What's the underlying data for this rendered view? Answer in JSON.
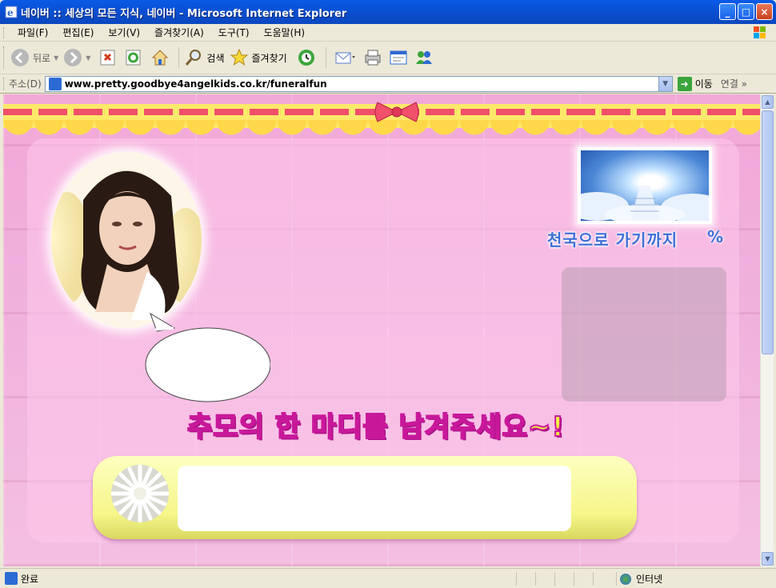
{
  "window": {
    "title": "네이버 :: 세상의 모든 지식, 네이버 - Microsoft Internet Explorer",
    "buttons": {
      "minimize": "_",
      "maximize": "□",
      "close": "×"
    }
  },
  "menu": {
    "items": [
      "파일(F)",
      "편집(E)",
      "보기(V)",
      "즐겨찾기(A)",
      "도구(T)",
      "도움말(H)"
    ]
  },
  "toolbar": {
    "back_label": "뒤로",
    "search_label": "검색",
    "favorites_label": "즐겨찾기"
  },
  "address": {
    "label": "주소(D)",
    "url": "www.pretty.goodbye4angelkids.co.kr/funeralfun",
    "go_label": "이동",
    "links_label": "연결 »"
  },
  "page": {
    "heaven_caption": "천국으로 가기까지",
    "heaven_percent": "%",
    "headline": "추모의 한 마디를 남겨주세요~!",
    "message_value": "",
    "speech_bubble_text": ""
  },
  "status": {
    "text": "완료",
    "zone": "인터넷"
  },
  "colors": {
    "xp_title_blue": "#0a5ae6",
    "page_pink": "#f2a8d8",
    "headline_fill": "#f0ff3a",
    "headline_stroke": "#c8189a",
    "heaven_text": "#3d6fd6"
  }
}
